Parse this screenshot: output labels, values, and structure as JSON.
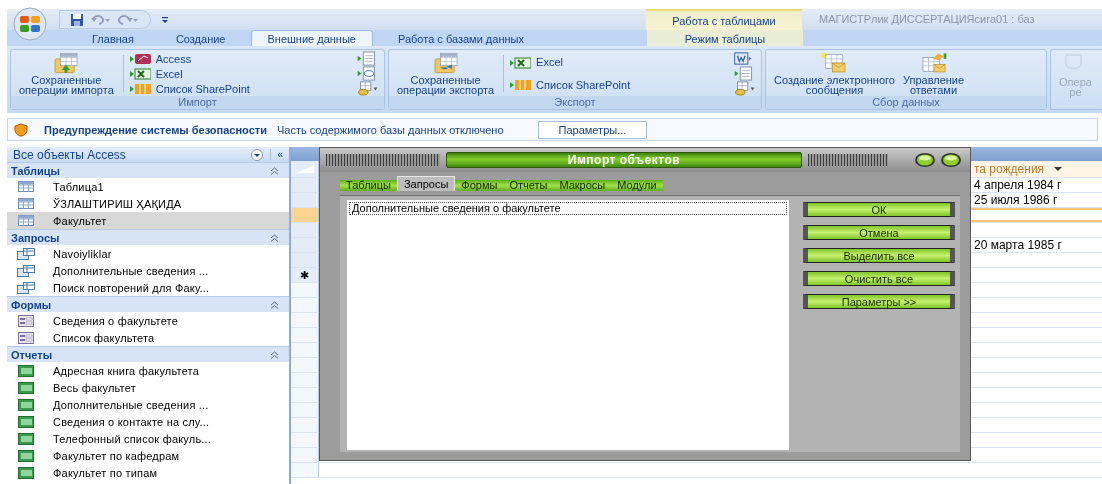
{
  "titlebar": {
    "context_tab": "Работа с таблицами",
    "title": "МАГИСТРлик ДИССЕРТАЦИЯсига01 : баз"
  },
  "tabs": [
    {
      "label": "Главная",
      "selected": false,
      "kind": "main"
    },
    {
      "label": "Создание",
      "selected": false,
      "kind": "main"
    },
    {
      "label": "Внешние данные",
      "selected": true,
      "kind": "main"
    },
    {
      "label": "Работа с базами данных",
      "selected": false,
      "kind": "main"
    },
    {
      "label": "Режим таблицы",
      "selected": false,
      "kind": "context"
    }
  ],
  "ribbon": {
    "groups": [
      {
        "label": "Импорт",
        "large": [
          {
            "label": "Сохраненные\nоперации импорта",
            "kind": "import",
            "disabled": false
          }
        ],
        "small": [
          {
            "label": "Access",
            "kind": "access"
          },
          {
            "label": "Excel",
            "kind": "excel"
          },
          {
            "label": "Список SharePoint",
            "kind": "sharepoint"
          }
        ],
        "icon_buttons": [
          {
            "kind": "text"
          },
          {
            "kind": "xml"
          },
          {
            "kind": "more"
          }
        ]
      },
      {
        "label": "Экспорт",
        "large": [
          {
            "label": "Сохраненные\nоперации экспорта",
            "kind": "export",
            "disabled": false
          }
        ],
        "small": [
          {
            "label": "Excel",
            "kind": "excel"
          },
          {
            "label": "Список SharePoint",
            "kind": "sharepoint"
          }
        ],
        "icon_buttons": [
          {
            "kind": "word"
          },
          {
            "kind": "text"
          },
          {
            "kind": "more"
          }
        ]
      },
      {
        "label": "Сбор данных",
        "large": [
          {
            "label": "Создание электронного\nсообщения",
            "kind": "mail",
            "disabled": false
          },
          {
            "label": "Управление\nответами",
            "kind": "replies",
            "disabled": false
          }
        ]
      },
      {
        "large": [
          {
            "label": "Опера\nре",
            "kind": "offline",
            "disabled": true
          }
        ]
      }
    ]
  },
  "security_bar": {
    "title": "Предупреждение системы безопасности",
    "message": "Часть содержимого базы данных отключено",
    "button": "Параметры..."
  },
  "nav_pane": {
    "title": "Все объекты Access",
    "collapse": "«",
    "groups": [
      {
        "label": "Таблицы",
        "kind": "table",
        "items": [
          {
            "label": "Таблица1",
            "selected": false
          },
          {
            "label": "ЎЗЛАШТИРИШ ҲАҚИДА",
            "selected": false
          },
          {
            "label": "Факультет",
            "selected": true
          }
        ]
      },
      {
        "label": "Запросы",
        "kind": "query",
        "items": [
          {
            "label": "Navoiyliklar",
            "selected": false
          },
          {
            "label": "Дополнительные сведения ...",
            "selected": false
          },
          {
            "label": "Поиск повторений для Факу...",
            "selected": false
          }
        ]
      },
      {
        "label": "Формы",
        "kind": "form",
        "items": [
          {
            "label": "Сведения о факультете",
            "selected": false
          },
          {
            "label": "Список факультета",
            "selected": false
          }
        ]
      },
      {
        "label": "Отчеты",
        "kind": "report",
        "items": [
          {
            "label": "Адресная книга факультета",
            "selected": false
          },
          {
            "label": "Весь факультет",
            "selected": false
          },
          {
            "label": "Дополнительные сведения ...",
            "selected": false
          },
          {
            "label": "Сведения о контакте на слу...",
            "selected": false
          },
          {
            "label": "Телефонный список факуль...",
            "selected": false
          },
          {
            "label": "Факультет по кафедрам",
            "selected": false
          },
          {
            "label": "Факультет по типам",
            "selected": false
          }
        ]
      }
    ]
  },
  "datasheet": {
    "column": "та рождения",
    "new_row_marker": "✱",
    "rows": [
      {
        "cell": "4 апреля 1984 г",
        "selected": false
      },
      {
        "cell": "25 июля 1986 г",
        "selected": false
      },
      {
        "selected": true
      },
      {
        "selected": false
      },
      {
        "cell": "20 марта 1985 г",
        "selected": false
      },
      {
        "selected": false
      }
    ]
  },
  "dialog": {
    "title": "Импорт объектов",
    "tabs": [
      {
        "label": "Таблицы",
        "selected": false
      },
      {
        "label": "Запросы",
        "selected": true
      },
      {
        "label": "Формы",
        "selected": false
      },
      {
        "label": "Отчеты",
        "selected": false
      },
      {
        "label": "Макросы",
        "selected": false
      },
      {
        "label": "Модули",
        "selected": false
      }
    ],
    "list": [
      {
        "label": "Дополнительные сведения о факультете",
        "selected": true
      }
    ],
    "buttons": [
      "ОК",
      "Отмена",
      "Выделить все",
      "Очистить все",
      "Параметры >>"
    ]
  }
}
